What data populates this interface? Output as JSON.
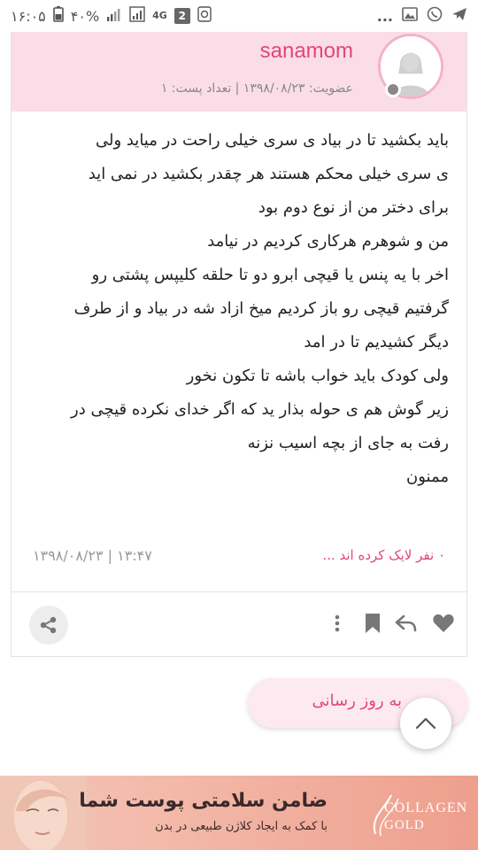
{
  "statusbar": {
    "time": "۱۶:۰۵",
    "battery": "۴۰%",
    "network": "4G",
    "sim_badge": "2",
    "more": "..."
  },
  "post": {
    "username": "sanamom",
    "member_meta": "عضویت: ۱۳۹۸/۰۸/۲۳ | تعداد پست: ۱",
    "lines": [
      "باید بکشید تا در بیاد ی سری خیلی راحت در میاید ولی",
      "ی سری خیلی محکم هستند هر چقدر بکشید در نمی اید",
      "برای دختر من از نوع دوم بود",
      "من و شوهرم هرکاری کردیم در نیامد",
      "اخر با یه پنس یا قیچی ابرو دو تا حلقه کلیپس پشتی رو",
      "گرفتیم قیچی رو  باز کردیم  میخ ازاد شه در بیاد و از طرف",
      "دیگر کشیدیم تا در امد",
      "ولی کودک باید خواب باشه تا تکون نخور",
      "زیر گوش هم ی حوله بذار ید که اگر خدای نکرده قیچی در",
      "رفت به جای از بچه اسیب نزنه",
      "ممنون"
    ],
    "likes": "۰ نفر لایک کرده اند ...",
    "date": "۱۳:۴۷ | ۱۳۹۸/۰۸/۲۳"
  },
  "refresh": {
    "label": "به روز رسانی"
  },
  "ad": {
    "headline": "ضامن سلامتی پوست شما",
    "subline": "با کمک به ایجاد کلاژن طبیعی در بدن",
    "logo_line1": "COLLAGEN",
    "logo_line2": "GOLD"
  },
  "colors": {
    "accent": "#e0467a",
    "header_bg": "#fbdde7"
  },
  "icons": [
    "telegram-icon",
    "whatsapp-icon",
    "gallery-icon",
    "heart-icon",
    "reply-icon",
    "bookmark-icon",
    "more-vertical-icon",
    "share-icon",
    "chevron-up-icon"
  ]
}
